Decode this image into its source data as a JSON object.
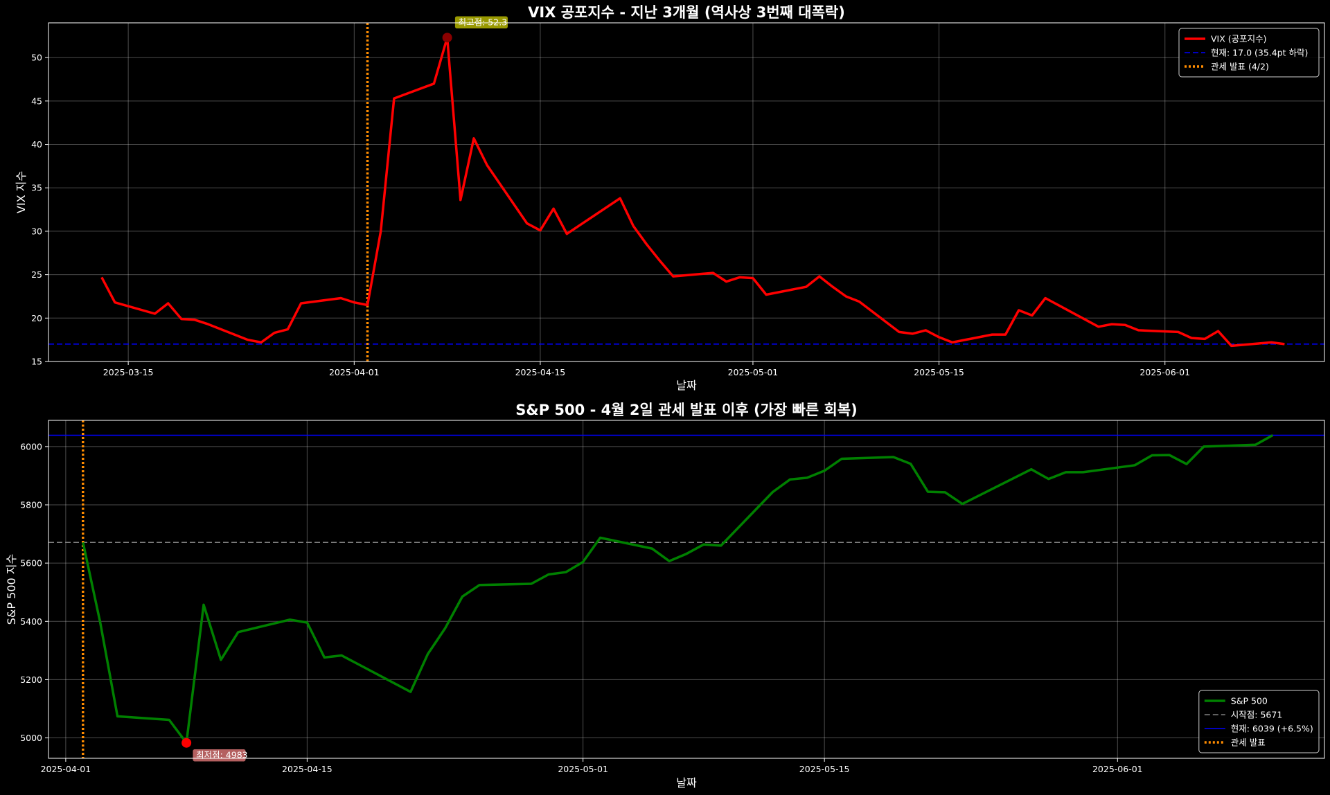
{
  "chart_data": [
    {
      "type": "line",
      "title": "VIX 공포지수 - 지난 3개월 (역사상 3번째 대폭락)",
      "xlabel": "날짜",
      "ylabel": "VIX 지수",
      "x_range": [
        "2025-03-09",
        "2025-06-13"
      ],
      "ylim": [
        15,
        54
      ],
      "yticks": [
        15,
        20,
        25,
        30,
        35,
        40,
        45,
        50
      ],
      "xticks": [
        "2025-03-15",
        "2025-04-01",
        "2025-04-15",
        "2025-05-01",
        "2025-05-15",
        "2025-06-01"
      ],
      "grid": true,
      "legend_position": "top-right",
      "series": [
        {
          "name": "VIX (공포지수)",
          "color": "#ff0000",
          "x": [
            "2025-03-13",
            "2025-03-14",
            "2025-03-17",
            "2025-03-18",
            "2025-03-19",
            "2025-03-20",
            "2025-03-21",
            "2025-03-24",
            "2025-03-25",
            "2025-03-26",
            "2025-03-27",
            "2025-03-28",
            "2025-03-31",
            "2025-04-01",
            "2025-04-02",
            "2025-04-03",
            "2025-04-04",
            "2025-04-07",
            "2025-04-08",
            "2025-04-09",
            "2025-04-10",
            "2025-04-11",
            "2025-04-14",
            "2025-04-15",
            "2025-04-16",
            "2025-04-17",
            "2025-04-21",
            "2025-04-22",
            "2025-04-23",
            "2025-04-24",
            "2025-04-25",
            "2025-04-28",
            "2025-04-29",
            "2025-04-30",
            "2025-05-01",
            "2025-05-02",
            "2025-05-05",
            "2025-05-06",
            "2025-05-07",
            "2025-05-08",
            "2025-05-09",
            "2025-05-12",
            "2025-05-13",
            "2025-05-14",
            "2025-05-15",
            "2025-05-16",
            "2025-05-19",
            "2025-05-20",
            "2025-05-21",
            "2025-05-22",
            "2025-05-23",
            "2025-05-27",
            "2025-05-28",
            "2025-05-29",
            "2025-05-30",
            "2025-06-02",
            "2025-06-03",
            "2025-06-04",
            "2025-06-05",
            "2025-06-06",
            "2025-06-09",
            "2025-06-10"
          ],
          "values": [
            24.7,
            21.8,
            20.5,
            21.7,
            19.9,
            19.8,
            19.3,
            17.5,
            17.2,
            18.3,
            18.7,
            21.7,
            22.3,
            21.8,
            21.5,
            30.0,
            45.3,
            47.0,
            52.3,
            33.6,
            40.7,
            37.6,
            30.9,
            30.1,
            32.6,
            29.7,
            33.8,
            30.6,
            28.5,
            26.6,
            24.8,
            25.2,
            24.2,
            24.7,
            24.6,
            22.7,
            23.6,
            24.8,
            23.6,
            22.5,
            21.9,
            18.4,
            18.2,
            18.6,
            17.8,
            17.2,
            18.1,
            18.1,
            20.9,
            20.3,
            22.3,
            19.0,
            19.3,
            19.2,
            18.6,
            18.4,
            17.7,
            17.6,
            18.5,
            16.8,
            17.2,
            17.0
          ]
        }
      ],
      "reference_lines": [
        {
          "label": "현재: 17.0 (35.4pt 하락)",
          "orientation": "horizontal",
          "value": 17.0,
          "color": "#0000ff",
          "style": "dashed"
        },
        {
          "label": "관세 발표 (4/2)",
          "orientation": "vertical",
          "value": "2025-04-02",
          "color": "#ff8c00",
          "style": "dotted"
        }
      ],
      "annotations": [
        {
          "label": "최고점: 52.3",
          "x": "2025-04-08",
          "y": 52.3,
          "marker_color": "#8b0000",
          "box_color": "#cccc00"
        }
      ]
    },
    {
      "type": "line",
      "title": "S&P 500 - 4월 2일 관세 발표 이후 (가장 빠른 회복)",
      "xlabel": "날짜",
      "ylabel": "S&P 500 지수",
      "x_range": [
        "2025-03-31",
        "2025-06-13"
      ],
      "ylim": [
        4930,
        6090
      ],
      "yticks": [
        5000,
        5200,
        5400,
        5600,
        5800,
        6000
      ],
      "xticks": [
        "2025-04-01",
        "2025-04-15",
        "2025-05-01",
        "2025-05-15",
        "2025-06-01"
      ],
      "grid": true,
      "legend_position": "bottom-right",
      "series": [
        {
          "name": "S&P 500",
          "color": "#008000",
          "x": [
            "2025-04-02",
            "2025-04-03",
            "2025-04-04",
            "2025-04-07",
            "2025-04-08",
            "2025-04-09",
            "2025-04-10",
            "2025-04-11",
            "2025-04-14",
            "2025-04-15",
            "2025-04-16",
            "2025-04-17",
            "2025-04-21",
            "2025-04-22",
            "2025-04-23",
            "2025-04-24",
            "2025-04-25",
            "2025-04-28",
            "2025-04-29",
            "2025-04-30",
            "2025-05-01",
            "2025-05-02",
            "2025-05-05",
            "2025-05-06",
            "2025-05-07",
            "2025-05-08",
            "2025-05-09",
            "2025-05-12",
            "2025-05-13",
            "2025-05-14",
            "2025-05-15",
            "2025-05-16",
            "2025-05-19",
            "2025-05-20",
            "2025-05-21",
            "2025-05-22",
            "2025-05-23",
            "2025-05-27",
            "2025-05-28",
            "2025-05-29",
            "2025-05-30",
            "2025-06-02",
            "2025-06-03",
            "2025-06-04",
            "2025-06-05",
            "2025-06-06",
            "2025-06-09",
            "2025-06-10"
          ],
          "values": [
            5671,
            5396,
            5074,
            5062,
            4983,
            5457,
            5268,
            5363,
            5406,
            5396,
            5276,
            5283,
            5158,
            5288,
            5376,
            5485,
            5525,
            5529,
            5561,
            5569,
            5604,
            5687,
            5650,
            5607,
            5632,
            5664,
            5660,
            5844,
            5887,
            5893,
            5917,
            5958,
            5964,
            5941,
            5845,
            5843,
            5803,
            5922,
            5889,
            5912,
            5912,
            5936,
            5970,
            5971,
            5940,
            6000,
            6006,
            6039
          ]
        }
      ],
      "reference_lines": [
        {
          "label": "시작점: 5671",
          "orientation": "horizontal",
          "value": 5671,
          "color": "#808080",
          "style": "dashed"
        },
        {
          "label": "현재: 6039 (+6.5%)",
          "orientation": "horizontal",
          "value": 6039,
          "color": "#0000ff",
          "style": "solid"
        },
        {
          "label": "관세 발표",
          "orientation": "vertical",
          "value": "2025-04-02",
          "color": "#ff8c00",
          "style": "dotted"
        }
      ],
      "annotations": [
        {
          "label": "최저점: 4983",
          "x": "2025-04-08",
          "y": 4983,
          "marker_color": "#ff0000",
          "box_color": "#f08080"
        }
      ]
    }
  ]
}
